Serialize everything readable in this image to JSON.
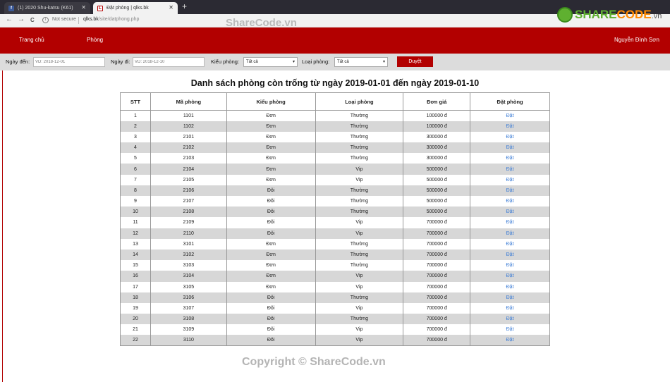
{
  "browser": {
    "tabs": [
      {
        "title": "(1) 2020 Shu-katsu (K61)",
        "close": "✕"
      },
      {
        "title": "Đặt phòng | qlks.bk",
        "close": "✕"
      }
    ],
    "new_tab": "+",
    "nav": {
      "back": "←",
      "forward": "→",
      "reload": "C"
    },
    "not_secure": "Not secure",
    "url_host": "qlks.bk",
    "url_path": "/site/datphong.php"
  },
  "watermark": {
    "top": "ShareCode.vn",
    "bottom": "Copyright © ShareCode.vn",
    "logo_main": "SHARE",
    "logo_accent": "CODE",
    "logo_suffix": ".vn"
  },
  "header": {
    "nav_home": "Trang chủ",
    "nav_rooms": "Phòng",
    "user": "Nguyễn Đình Sơn"
  },
  "filter": {
    "arrive_label": "Ngày đến:",
    "arrive_placeholder": "VD: 2018-12-01",
    "leave_label": "Ngày đi:",
    "leave_placeholder": "VD: 2018-12-10",
    "room_kind_label": "Kiểu phòng:",
    "room_kind_value": "Tất cả",
    "room_type_label": "Loại phòng:",
    "room_type_value": "Tất cả",
    "browse_button": "Duyệt"
  },
  "page_title": "Danh sách phòng còn trống từ ngày 2019-01-01 đến ngày 2019-01-10",
  "table": {
    "headers": [
      "STT",
      "Mã phòng",
      "Kiểu phòng",
      "Loại phòng",
      "Đơn giá",
      "Đặt phòng"
    ],
    "rows": [
      [
        "1",
        "1101",
        "Đơn",
        "Thường",
        "100000 đ",
        "Đặt"
      ],
      [
        "2",
        "1102",
        "Đơn",
        "Thường",
        "100000 đ",
        "Đặt"
      ],
      [
        "3",
        "2101",
        "Đơn",
        "Thường",
        "300000 đ",
        "Đặt"
      ],
      [
        "4",
        "2102",
        "Đơn",
        "Thường",
        "300000 đ",
        "Đặt"
      ],
      [
        "5",
        "2103",
        "Đơn",
        "Thường",
        "300000 đ",
        "Đặt"
      ],
      [
        "6",
        "2104",
        "Đơn",
        "Vip",
        "500000 đ",
        "Đặt"
      ],
      [
        "7",
        "2105",
        "Đơn",
        "Vip",
        "500000 đ",
        "Đặt"
      ],
      [
        "8",
        "2106",
        "Đôi",
        "Thường",
        "500000 đ",
        "Đặt"
      ],
      [
        "9",
        "2107",
        "Đôi",
        "Thường",
        "500000 đ",
        "Đặt"
      ],
      [
        "10",
        "2108",
        "Đôi",
        "Thường",
        "500000 đ",
        "Đặt"
      ],
      [
        "11",
        "2109",
        "Đôi",
        "Vip",
        "700000 đ",
        "Đặt"
      ],
      [
        "12",
        "2110",
        "Đôi",
        "Vip",
        "700000 đ",
        "Đặt"
      ],
      [
        "13",
        "3101",
        "Đơn",
        "Thường",
        "700000 đ",
        "Đặt"
      ],
      [
        "14",
        "3102",
        "Đơn",
        "Thường",
        "700000 đ",
        "Đặt"
      ],
      [
        "15",
        "3103",
        "Đơn",
        "Thường",
        "700000 đ",
        "Đặt"
      ],
      [
        "16",
        "3104",
        "Đơn",
        "Vip",
        "700000 đ",
        "Đặt"
      ],
      [
        "17",
        "3105",
        "Đơn",
        "Vip",
        "700000 đ",
        "Đặt"
      ],
      [
        "18",
        "3106",
        "Đôi",
        "Thường",
        "700000 đ",
        "Đặt"
      ],
      [
        "19",
        "3107",
        "Đôi",
        "Vip",
        "700000 đ",
        "Đặt"
      ],
      [
        "20",
        "3108",
        "Đôi",
        "Thường",
        "700000 đ",
        "Đặt"
      ],
      [
        "21",
        "3109",
        "Đôi",
        "Vip",
        "700000 đ",
        "Đặt"
      ],
      [
        "22",
        "3110",
        "Đôi",
        "Vip",
        "700000 đ",
        "Đặt"
      ]
    ]
  }
}
